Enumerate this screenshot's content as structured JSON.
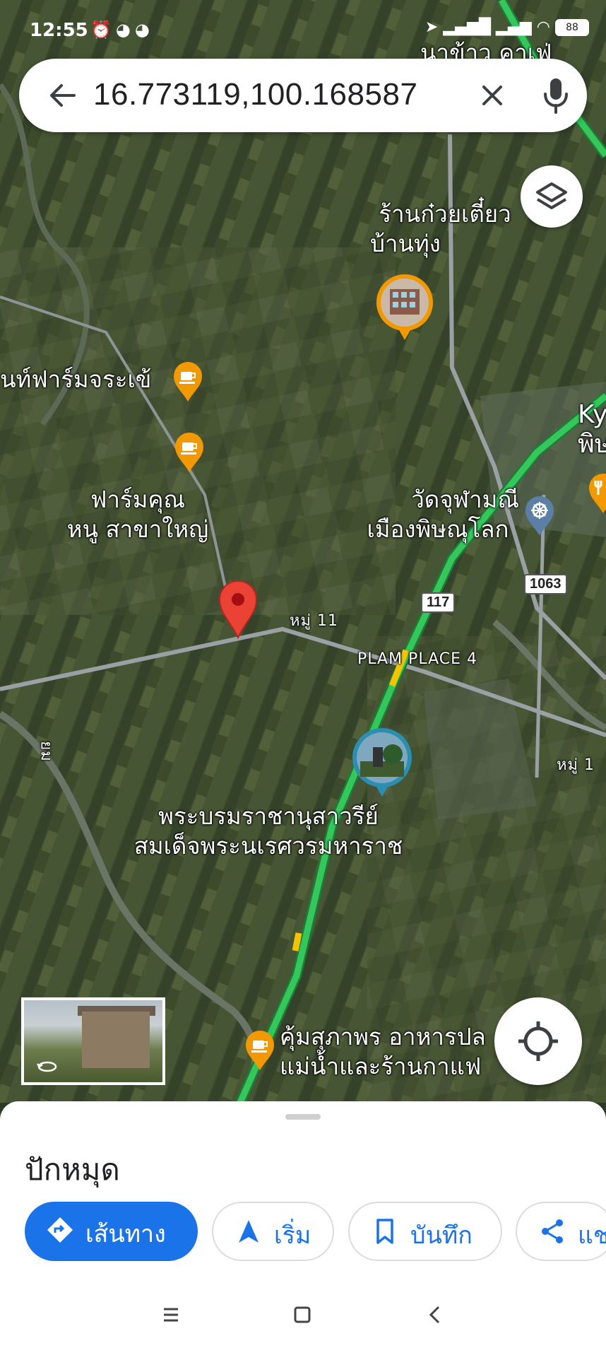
{
  "status_bar": {
    "time": "12:55",
    "notification_icons": [
      "alarm-icon",
      "app-icon",
      "app-icon"
    ],
    "battery_level": "88"
  },
  "search": {
    "query": "16.773119,100.168587",
    "back_icon": "arrow-left-icon",
    "clear_icon": "close-icon",
    "mic_icon": "microphone-icon"
  },
  "map": {
    "labels": {
      "top_edge": "นาข้าว คาเฟ่",
      "noodle_line1": "ร้านก๋วยเตี๋ยว",
      "noodle_line2": "บ้านทุ่ง",
      "farm_left": "นท์ฟาร์มจระเข้",
      "farm_khun_line1": "ฟาร์มคุณ",
      "farm_khun_line2": "หนู สาขาใหญ่",
      "temple_line1": "วัดจุฬามณี",
      "temple_line2": "เมืองพิษณุโลก",
      "ky_line1": "Ky",
      "ky_line2": "พิษ",
      "road_117": "117",
      "road_1063": "1063",
      "village_11": "หมู่ 11",
      "village_1": "หมู่ 1",
      "plam_place": "PLAM PLACE 4",
      "monument_line1": "พระบรมราชานุสาวรีย์",
      "monument_line2": "สมเด็จพระนเรศวรมหาราช",
      "river_label": "ยม",
      "kum_line1": "คุ้มสุภาพร อาหารปล",
      "kum_line2": "แม่น้ำและร้านกาแฟ"
    },
    "pin_color": "#ea4335",
    "route_color": "#34c759",
    "cafe_color": "#f29900",
    "temple_color": "#5b7fa6"
  },
  "sheet": {
    "title": "ปักหมุด",
    "actions": [
      {
        "label": "เส้นทาง",
        "icon": "directions-icon"
      },
      {
        "label": "เริ่ม",
        "icon": "navigation-arrow-icon"
      },
      {
        "label": "บันทึก",
        "icon": "bookmark-icon"
      },
      {
        "label": "แชร์",
        "icon": "share-icon"
      }
    ],
    "share_visible": "แช"
  },
  "colors": {
    "accent": "#1a73e8",
    "map_base": "#3a4a2a"
  }
}
